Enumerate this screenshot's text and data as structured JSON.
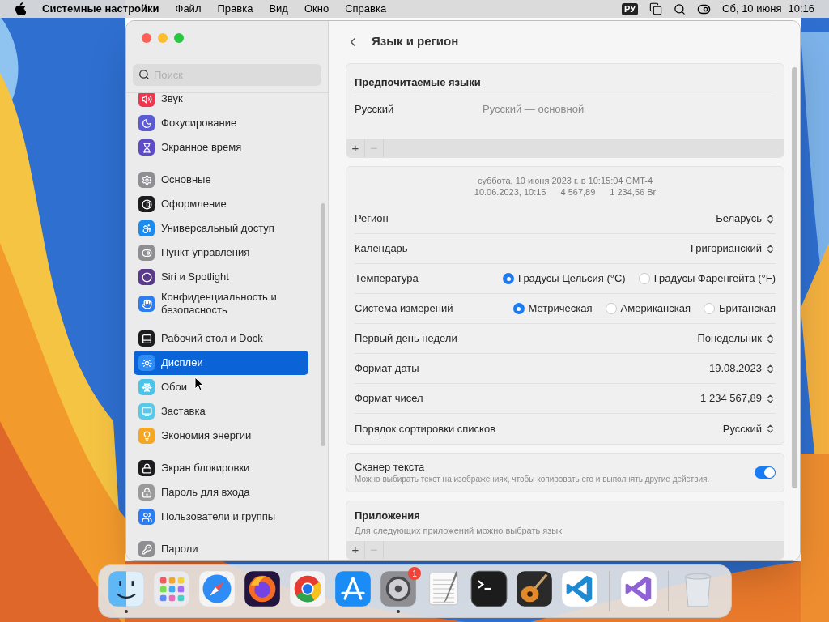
{
  "menu_bar": {
    "app_name": "Системные настройки",
    "menus": [
      "Файл",
      "Правка",
      "Вид",
      "Окно",
      "Справка"
    ],
    "input_source": "РУ",
    "date": "Сб, 10 июня",
    "time": "10:16"
  },
  "sidebar": {
    "search": {
      "placeholder": "Поиск"
    },
    "groups": [
      {
        "items": [
          {
            "label": "Звук",
            "color": "#f0364f",
            "selected": false
          },
          {
            "label": "Фокусирование",
            "color": "#5d5bd4",
            "selected": false
          },
          {
            "label": "Экранное время",
            "color": "#5d4bc8",
            "selected": false
          }
        ]
      },
      {
        "items": [
          {
            "label": "Основные",
            "color": "#8e8e93",
            "selected": false
          },
          {
            "label": "Оформление",
            "color": "#1c1c1e",
            "selected": false
          },
          {
            "label": "Универсальный доступ",
            "color": "#1a8cf0",
            "selected": false
          },
          {
            "label": "Пункт управления",
            "color": "#8e8e93",
            "selected": false
          },
          {
            "label": "Siri и Spotlight",
            "color": "#5a3a8a",
            "selected": false
          },
          {
            "label": "Конфиденциальность и безопасность",
            "color": "#2c7df0",
            "selected": false
          }
        ]
      },
      {
        "items": [
          {
            "label": "Рабочий стол и Dock",
            "color": "#1c1c1e",
            "selected": false
          },
          {
            "label": "Дисплеи",
            "color": "#2f8cf5",
            "selected": true
          },
          {
            "label": "Обои",
            "color": "#4cc3e8",
            "selected": false
          },
          {
            "label": "Заставка",
            "color": "#5ac8e8",
            "selected": false
          },
          {
            "label": "Экономия энергии",
            "color": "#f5a623",
            "selected": false
          }
        ]
      },
      {
        "items": [
          {
            "label": "Экран блокировки",
            "color": "#1c1c1e",
            "selected": false
          },
          {
            "label": "Пароль для входа",
            "color": "#9a9a9a",
            "selected": false
          },
          {
            "label": "Пользователи и группы",
            "color": "#2c7df0",
            "selected": false
          }
        ]
      },
      {
        "items": [
          {
            "label": "Пароли",
            "color": "#8e8e93",
            "selected": false
          }
        ]
      }
    ]
  },
  "content": {
    "title": "Язык и регион",
    "preferred_languages": {
      "title": "Предпочитаемые языки",
      "languages": [
        {
          "name": "Русский",
          "note": "Русский — основной"
        }
      ],
      "buttons": [
        {
          "label": "+",
          "disabled": false
        },
        {
          "label": "−",
          "disabled": true
        }
      ]
    },
    "region": {
      "preview_line_1": "суббота, 10 июня 2023 г. в 10:15:04 GMT-4",
      "preview_line_2": [
        "10.06.2023, 10:15",
        "4 567,89",
        "1 234,56 Br"
      ],
      "rows": [
        {
          "kind": "popup",
          "label": "Регион",
          "value": "Беларусь"
        },
        {
          "kind": "popup",
          "label": "Календарь",
          "value": "Григорианский"
        },
        {
          "kind": "radio",
          "label": "Температура",
          "options": [
            {
              "label": "Градусы Цельсия (°C)",
              "selected": true
            },
            {
              "label": "Градусы Фаренгейта (°F)",
              "selected": false
            }
          ]
        },
        {
          "kind": "radio",
          "label": "Система измерений",
          "options": [
            {
              "label": "Метрическая",
              "selected": true
            },
            {
              "label": "Американская",
              "selected": false
            },
            {
              "label": "Британская",
              "selected": false
            }
          ]
        },
        {
          "kind": "popup",
          "label": "Первый день недели",
          "value": "Понедельник"
        },
        {
          "kind": "popup",
          "label": "Формат даты",
          "value": "19.08.2023"
        },
        {
          "kind": "popup",
          "label": "Формат чисел",
          "value": "1 234 567,89"
        },
        {
          "kind": "popup",
          "label": "Порядок сортировки списков",
          "value": "Русский"
        }
      ]
    },
    "live_text": {
      "title": "Сканер текста",
      "description": "Можно выбирать текст на изображениях, чтобы копировать его и выполнять другие действия.",
      "on": true
    },
    "applications": {
      "title": "Приложения",
      "description": "Для следующих приложений можно выбрать язык:",
      "buttons": [
        {
          "label": "+",
          "disabled": false
        },
        {
          "label": "−",
          "disabled": true
        }
      ]
    }
  },
  "dock": {
    "groups": [
      [
        {
          "running": true
        },
        {
          "running": false
        },
        {
          "running": false
        },
        {
          "running": false
        },
        {
          "running": false
        },
        {
          "running": false
        },
        {
          "running": true,
          "badge": "1"
        },
        {
          "running": false
        },
        {
          "running": false
        },
        {
          "running": false
        },
        {
          "running": false
        }
      ],
      [
        {
          "running": false
        }
      ],
      [
        {
          "running": false
        }
      ]
    ]
  }
}
